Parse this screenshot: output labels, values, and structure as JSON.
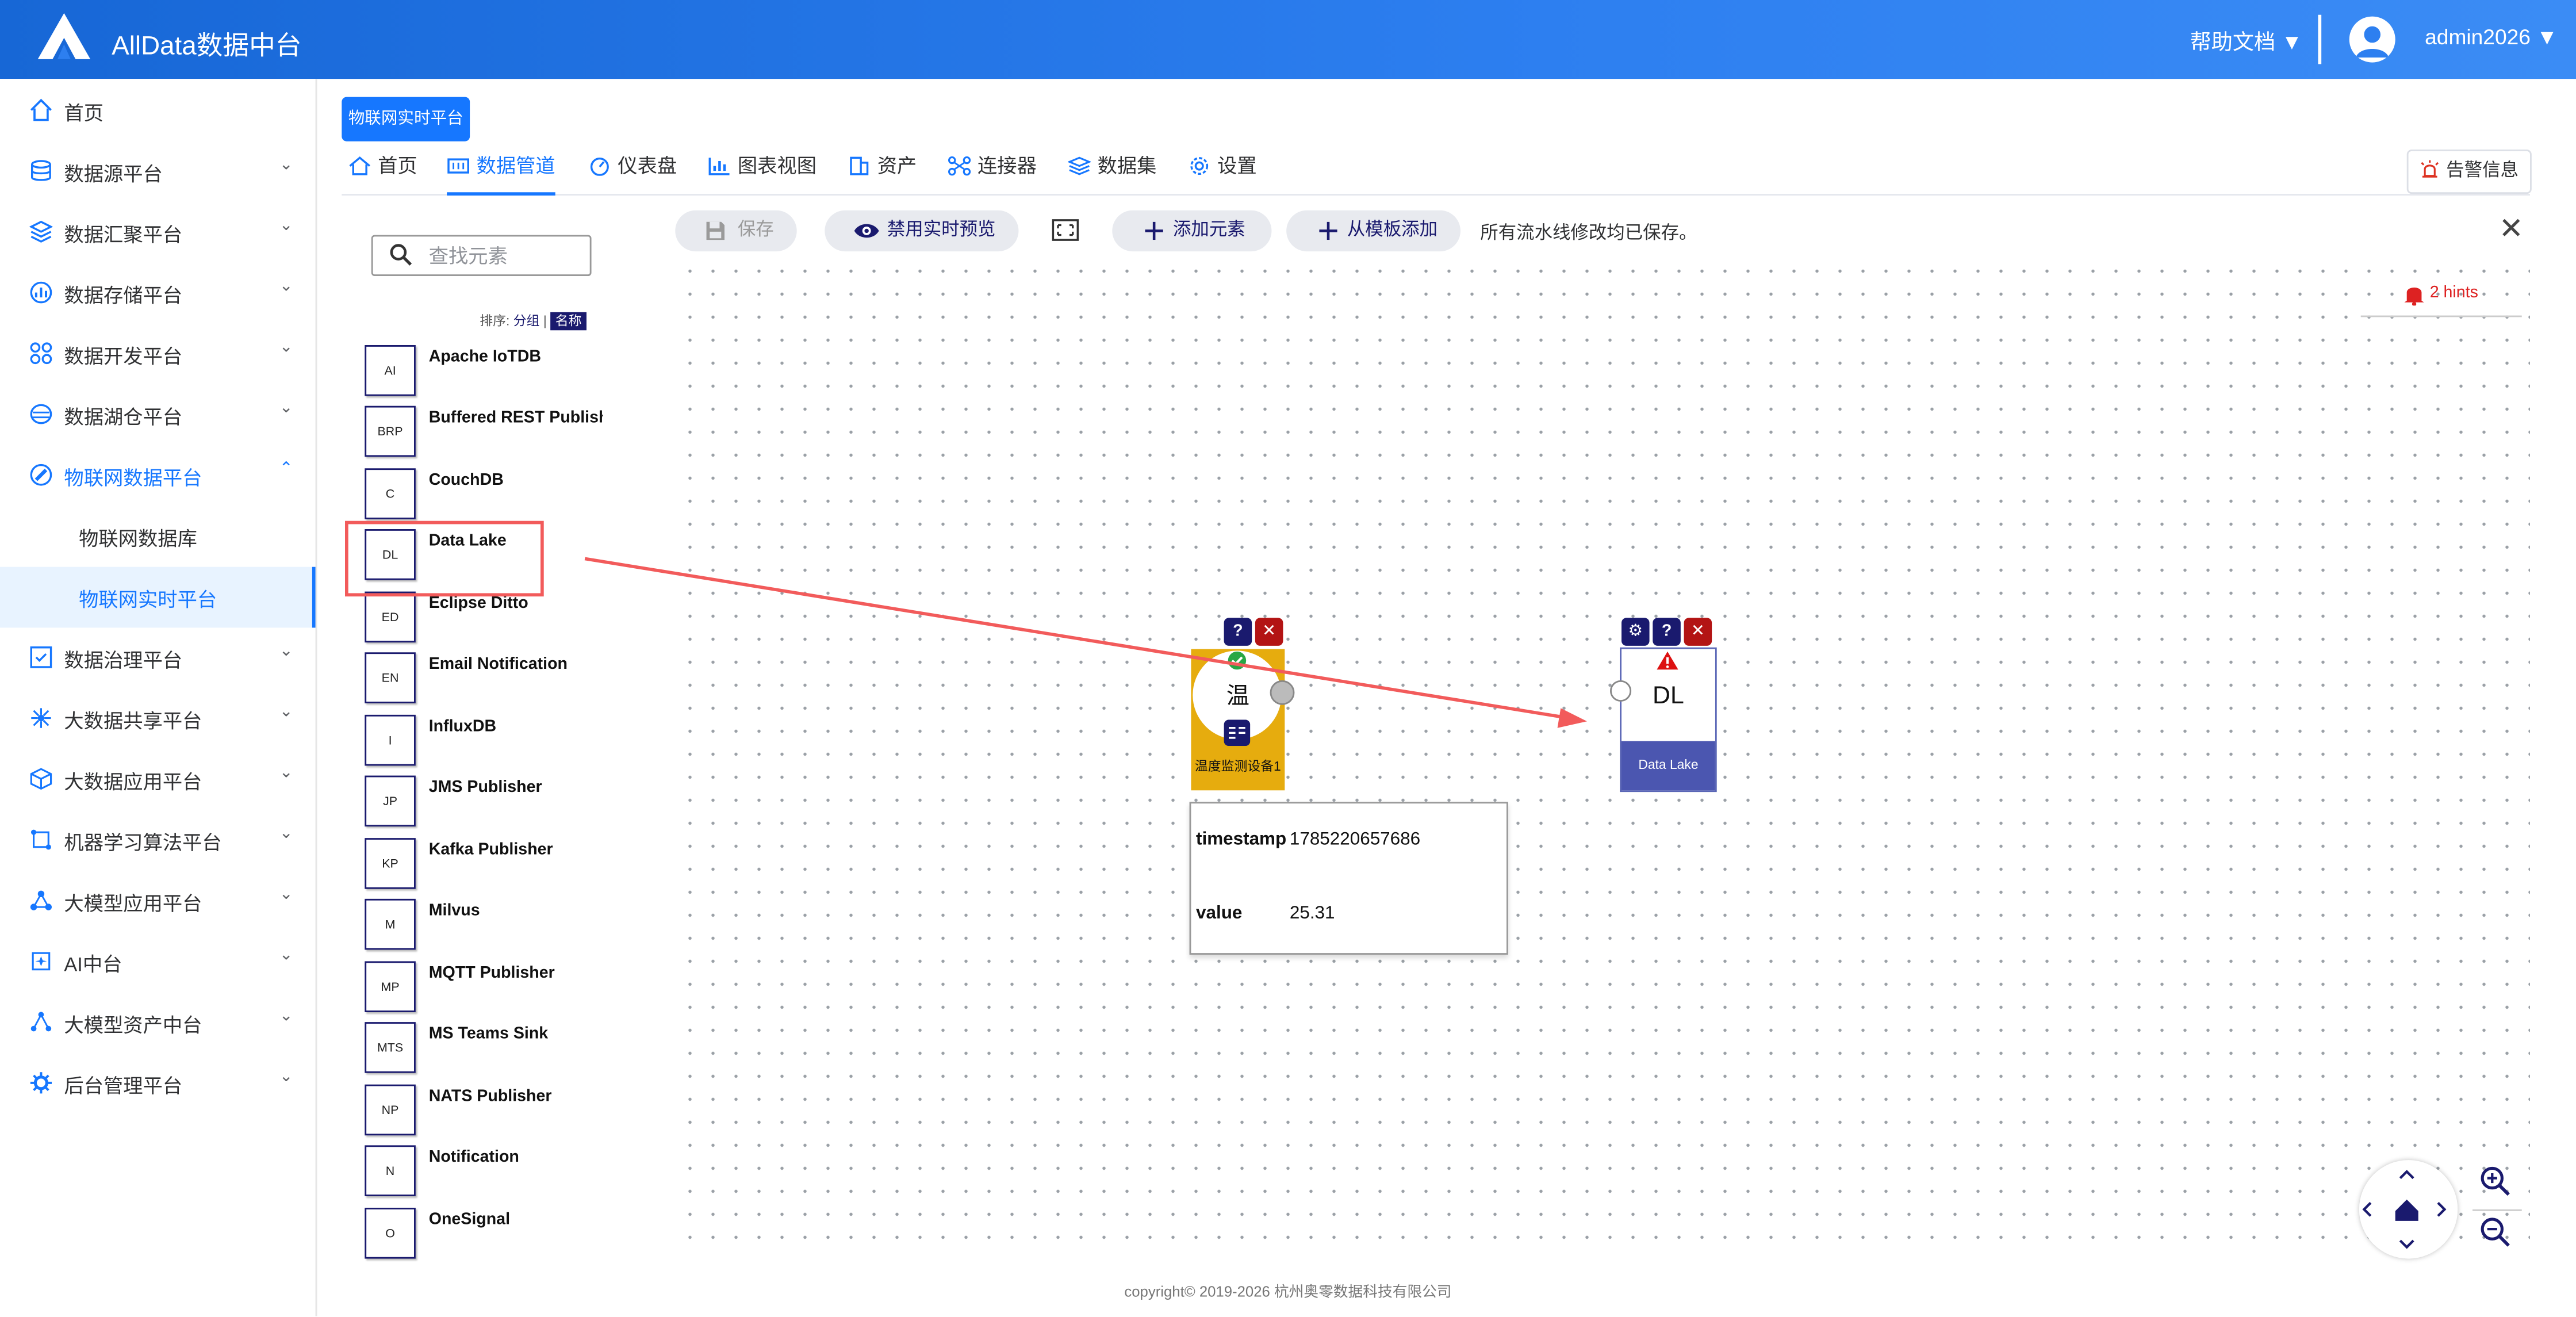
{
  "header": {
    "app_title": "AllData数据中台",
    "help_label": "帮助文档 ▼",
    "user_label": "admin2026 ▼"
  },
  "sidebar": {
    "items": [
      {
        "label": "首页",
        "icon": "home-icon"
      },
      {
        "label": "数据源平台",
        "icon": "database-icon"
      },
      {
        "label": "数据汇聚平台",
        "icon": "layers-icon"
      },
      {
        "label": "数据存储平台",
        "icon": "storage-icon"
      },
      {
        "label": "数据开发平台",
        "icon": "grid-icon"
      },
      {
        "label": "数据湖仓平台",
        "icon": "lake-icon"
      },
      {
        "label": "物联网数据平台",
        "icon": "iot-icon"
      },
      {
        "label": "数据治理平台",
        "icon": "governance-icon"
      },
      {
        "label": "大数据共享平台",
        "icon": "share-icon"
      },
      {
        "label": "大数据应用平台",
        "icon": "cube-icon"
      },
      {
        "label": "机器学习算法平台",
        "icon": "ml-icon"
      },
      {
        "label": "大模型应用平台",
        "icon": "model-icon"
      },
      {
        "label": "AI中台",
        "icon": "ai-icon"
      },
      {
        "label": "大模型资产中台",
        "icon": "asset-icon"
      },
      {
        "label": "后台管理平台",
        "icon": "admin-icon"
      }
    ],
    "sub_items": [
      "物联网数据库",
      "物联网实时平台"
    ]
  },
  "page_tag": "物联网实时平台",
  "tabs": [
    {
      "label": "首页",
      "icon": "home-icon"
    },
    {
      "label": "数据管道",
      "icon": "pipeline-icon"
    },
    {
      "label": "仪表盘",
      "icon": "dashboard-icon"
    },
    {
      "label": "图表视图",
      "icon": "chart-icon"
    },
    {
      "label": "资产",
      "icon": "asset-icon"
    },
    {
      "label": "连接器",
      "icon": "connector-icon"
    },
    {
      "label": "数据集",
      "icon": "dataset-icon"
    },
    {
      "label": "设置",
      "icon": "gear-icon"
    }
  ],
  "alert_button": "告警信息",
  "palette": {
    "search_placeholder": "查找元素",
    "sort_label": "排序:",
    "sort_group": "分组",
    "sort_sep": "|",
    "sort_name": "名称",
    "components": [
      {
        "abbr": "AI",
        "name": "Apache IoTDB"
      },
      {
        "abbr": "BRP",
        "name": "Buffered REST Publisher"
      },
      {
        "abbr": "C",
        "name": "CouchDB"
      },
      {
        "abbr": "DL",
        "name": "Data Lake"
      },
      {
        "abbr": "ED",
        "name": "Eclipse Ditto"
      },
      {
        "abbr": "EN",
        "name": "Email Notification"
      },
      {
        "abbr": "I",
        "name": "InfluxDB"
      },
      {
        "abbr": "JP",
        "name": "JMS Publisher"
      },
      {
        "abbr": "KP",
        "name": "Kafka Publisher"
      },
      {
        "abbr": "M",
        "name": "Milvus"
      },
      {
        "abbr": "MP",
        "name": "MQTT Publisher"
      },
      {
        "abbr": "MTS",
        "name": "MS Teams Sink"
      },
      {
        "abbr": "NP",
        "name": "NATS Publisher"
      },
      {
        "abbr": "N",
        "name": "Notification"
      },
      {
        "abbr": "O",
        "name": "OneSignal"
      }
    ]
  },
  "toolbar": {
    "save": "保存",
    "disable_preview": "禁用实时预览",
    "add_element": "添加元素",
    "add_from_template": "从模板添加",
    "status_message": "所有流水线修改均已保存。"
  },
  "canvas": {
    "hints": "2 hints",
    "source_node": {
      "char": "温",
      "name": "温度监测设备1"
    },
    "sink_node": {
      "abbr": "DL",
      "name": "Data Lake"
    },
    "preview": {
      "rows": [
        {
          "key": "timestamp",
          "value": "1785220657686"
        },
        {
          "key": "value",
          "value": "25.31"
        }
      ]
    }
  },
  "footer": "copyright© 2019-2026 杭州奥零数据科技有限公司",
  "colors": {
    "primary": "#1677ff",
    "navy": "#1a1a6e",
    "source_node": "#e6ac0e",
    "sink_node": "#4b56b0",
    "highlight": "#f25b5b",
    "danger": "#b31414"
  }
}
